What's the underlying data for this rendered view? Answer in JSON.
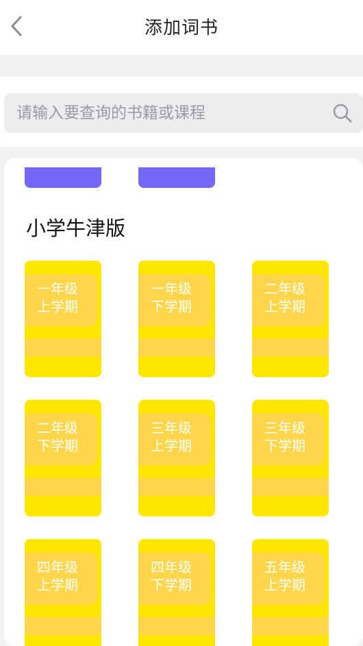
{
  "header": {
    "title": "添加词书"
  },
  "search": {
    "placeholder": "请输入要查询的书籍或课程"
  },
  "section": {
    "title": "小学牛津版"
  },
  "books": [
    {
      "line1": "一年级",
      "line2": "上学期"
    },
    {
      "line1": "一年级",
      "line2": "下学期"
    },
    {
      "line1": "二年级",
      "line2": "上学期"
    },
    {
      "line1": "二年级",
      "line2": "下学期"
    },
    {
      "line1": "三年级",
      "line2": "上学期"
    },
    {
      "line1": "三年级",
      "line2": "下学期"
    },
    {
      "line1": "四年级",
      "line2": "上学期"
    },
    {
      "line1": "四年级",
      "line2": "下学期"
    },
    {
      "line1": "五年级",
      "line2": "上学期"
    }
  ],
  "colors": {
    "book_primary": "#ffe600",
    "book_stripe": "#ffd54a",
    "previous_section_tab": "#7468f6"
  }
}
